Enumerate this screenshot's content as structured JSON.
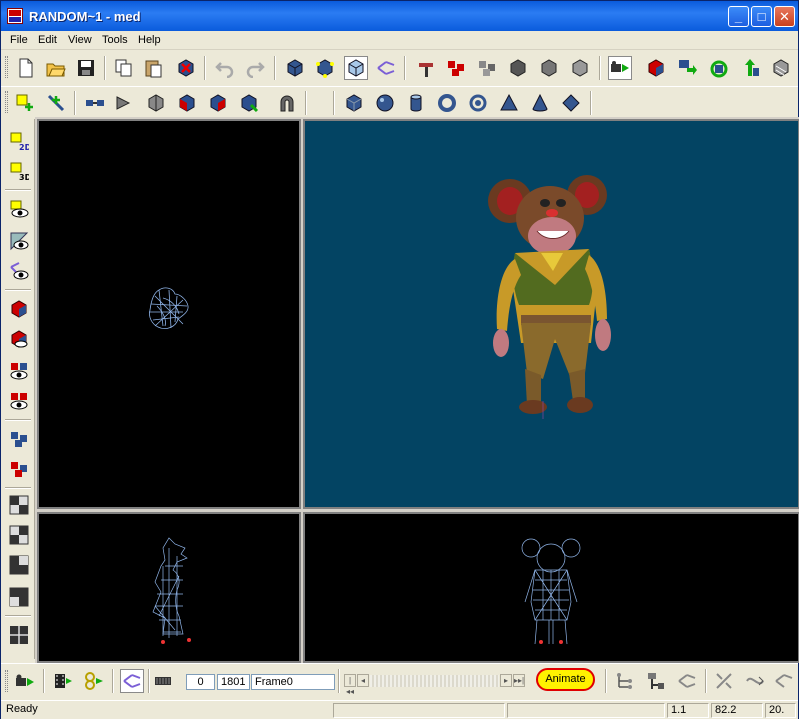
{
  "window": {
    "title": "RANDOM~1 - med",
    "minimize_glyph": "_",
    "maximize_glyph": "□",
    "close_glyph": "✕"
  },
  "menu": [
    "File",
    "Edit",
    "View",
    "Tools",
    "Help"
  ],
  "timeline": {
    "start_frame": "0",
    "end_frame": "1801",
    "frame_name": "Frame0",
    "animate_label": "Animate",
    "rewind_glyph": "|◂◂",
    "prev_glyph": "◂",
    "next_glyph": "▸",
    "end_glyph": "▸▸|"
  },
  "status": {
    "text": "Ready",
    "field1": "",
    "field2": "",
    "field3": "1.1",
    "field4": "82.2",
    "field5": "20."
  },
  "colors": {
    "titlebar": "#0a5bdc",
    "perspective_viewport": "#034463",
    "wire_viewport": "#000000",
    "animate_highlight": "#fff200",
    "animate_ring": "#e00000"
  },
  "icons": {
    "toolbar_main": [
      "new-file-icon",
      "open-folder-icon",
      "save-icon",
      "copy-icon",
      "paste-icon",
      "delete-icon",
      "undo-icon",
      "redo-icon",
      "solid-cube-icon",
      "vertex-cube-icon",
      "texture-cube-icon",
      "bone-link-icon",
      "paint-bone-icon",
      "red-blocks-icon",
      "grey-blocks-icon",
      "cube-dark-icon",
      "cube-grey-icon",
      "cube-light-icon",
      "camera-play-icon",
      "red-cube-icon",
      "move-down-icon",
      "rotate-icon",
      "move-up-icon",
      "cube-stripes-icon"
    ],
    "toolbar_second": [
      "add-point-icon",
      "add-joint-icon",
      "link-icon",
      "extrude-icon",
      "split-cube-icon",
      "red-face-icon",
      "red-cube-icon",
      "face-select-icon",
      "magnet-icon",
      "primitive-cube-icon",
      "primitive-sphere-icon",
      "primitive-cylinder-icon",
      "primitive-torus-icon",
      "primitive-tube-icon",
      "primitive-pyramid-icon",
      "primitive-cone-icon",
      "primitive-diamond-icon"
    ],
    "toolbar_left": [
      "view-2d-icon",
      "view-3d-icon",
      "eye-camera-icon",
      "eye-edit-icon",
      "eye-joint-icon",
      "red-cube-show-icon",
      "red-cube-hide-icon",
      "eye-cubes-icon",
      "eye-red-icon",
      "blue-blocks-icon",
      "red-blocks-icon",
      "layout-1-icon",
      "layout-2-icon",
      "layout-3-icon",
      "layout-4-icon",
      "layout-5-icon"
    ],
    "toolbar_bottom": [
      "camera-play-icon",
      "film-icon",
      "bone-play-icon",
      "bone-link-icon",
      "frame-strip-icon",
      "joint-tree-icon",
      "skeleton-icon",
      "bone-edit-icon",
      "mirror-bone-icon",
      "spline-icon",
      "bone-chain-icon"
    ]
  }
}
